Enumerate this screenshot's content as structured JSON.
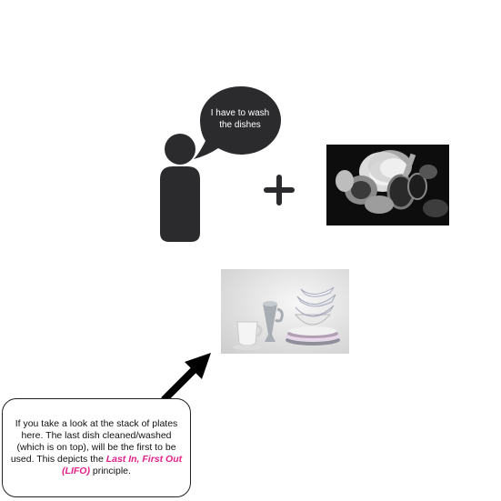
{
  "bubble": {
    "text": "I have to wash the dishes"
  },
  "operator": {
    "symbol": "+"
  },
  "photos": {
    "dirty_dishes": {
      "icon": "dirty-dishes-photo"
    },
    "clean_stack": {
      "icon": "clean-plate-stack-photo"
    }
  },
  "note": {
    "text_before": "If you take a look at the stack of plates here. The last dish cleaned/washed (which is on top), will be the first to be used. This depicts the ",
    "highlight": "Last In, First Out (LIFO)",
    "text_after": " principle."
  },
  "colors": {
    "dark": "#2b2b2e",
    "highlight": "#e0218a",
    "bubble": "#2b2b2e"
  }
}
